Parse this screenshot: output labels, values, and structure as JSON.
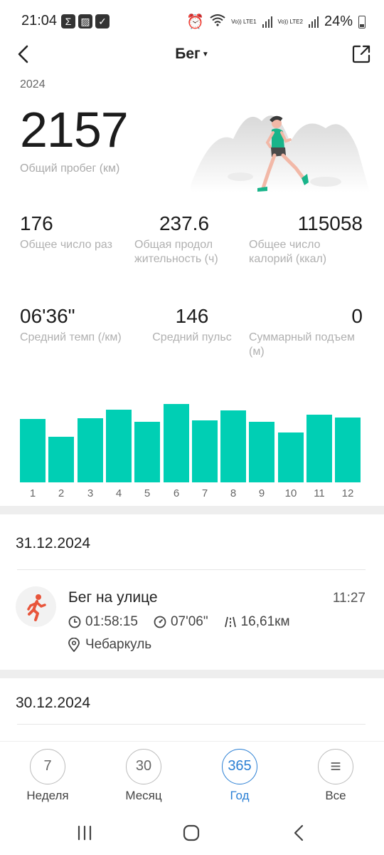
{
  "status_bar": {
    "time": "21:04",
    "battery": "24%",
    "lte1": "Vo)) LTE1",
    "lte2": "Vo)) LTE2"
  },
  "header": {
    "title": "Бег"
  },
  "summary": {
    "year": "2024",
    "total_distance": "2157",
    "total_distance_label": "Общий пробег (км)"
  },
  "stats": [
    {
      "value": "176",
      "label": "Общее число раз"
    },
    {
      "value": "237.6",
      "label": "Общая продол жительность (ч)"
    },
    {
      "value": "115058",
      "label": "Общее число калорий (ккал)"
    },
    {
      "value": "06'36\"",
      "label": "Средний темп (/км)"
    },
    {
      "value": "146",
      "label": "Средний пульс"
    },
    {
      "value": "0",
      "label": "Суммарный подъем (м)"
    }
  ],
  "chart_data": {
    "type": "bar",
    "categories": [
      "1",
      "2",
      "3",
      "4",
      "5",
      "6",
      "7",
      "8",
      "9",
      "10",
      "11",
      "12"
    ],
    "values": [
      0.76,
      0.55,
      0.77,
      0.87,
      0.73,
      0.94,
      0.74,
      0.86,
      0.73,
      0.6,
      0.81,
      0.78
    ],
    "ylim": [
      0,
      1
    ],
    "color": "#00cfb4"
  },
  "days": [
    {
      "date": "31.12.2024",
      "activity": {
        "title": "Бег на улице",
        "time": "11:27",
        "duration": "01:58:15",
        "pace": "07'06\"",
        "distance": "16,61км",
        "location": "Чебаркуль"
      }
    },
    {
      "date": "30.12.2024"
    }
  ],
  "tabs": [
    {
      "value": "7",
      "label": "Неделя"
    },
    {
      "value": "30",
      "label": "Месяц"
    },
    {
      "value": "365",
      "label": "Год"
    },
    {
      "value": "≡",
      "label": "Все"
    }
  ],
  "icons": {
    "back": "back-arrow-icon",
    "share": "share-icon",
    "running": "running-person-icon",
    "clock": "clock-icon",
    "pace": "gauge-icon",
    "distance": "road-icon",
    "location": "location-pin-icon"
  }
}
